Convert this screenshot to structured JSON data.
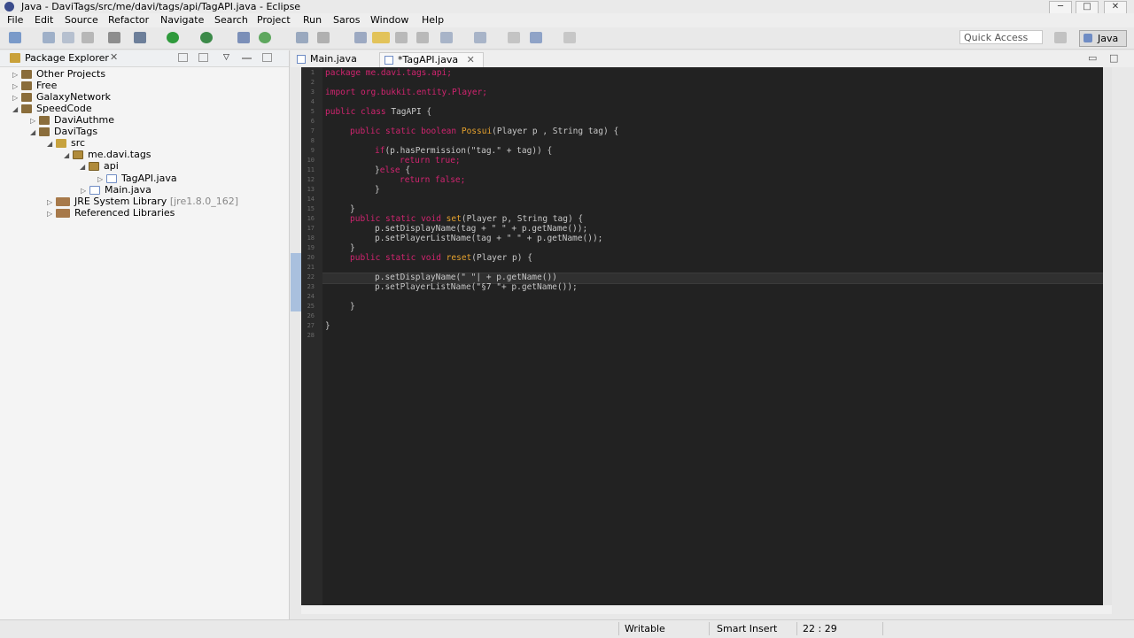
{
  "window": {
    "title": "Java - DaviTags/src/me/davi/tags/api/TagAPI.java - Eclipse",
    "minimize": "─",
    "maximize": "□",
    "close": "✕"
  },
  "menu": [
    "File",
    "Edit",
    "Source",
    "Refactor",
    "Navigate",
    "Search",
    "Project",
    "Run",
    "Saros",
    "Window",
    "Help"
  ],
  "toolbar": {
    "quick_access_placeholder": "Quick Access",
    "perspective_label": "Java"
  },
  "package_explorer": {
    "title": "Package Explorer",
    "close": "✕",
    "tree": [
      {
        "label": "Other Projects",
        "arrow": "▷",
        "icon": "project"
      },
      {
        "label": "Free",
        "arrow": "▷",
        "icon": "project"
      },
      {
        "label": "GalaxyNetwork",
        "arrow": "▷",
        "icon": "project"
      },
      {
        "label": "SpeedCode",
        "arrow": "◢",
        "icon": "project"
      },
      {
        "label": "DaviAuthme",
        "arrow": "▷",
        "icon": "project"
      },
      {
        "label": "DaviTags",
        "arrow": "◢",
        "icon": "project"
      },
      {
        "label": "src",
        "arrow": "◢",
        "icon": "source-folder"
      },
      {
        "label": "me.davi.tags",
        "arrow": "◢",
        "icon": "package"
      },
      {
        "label": "api",
        "arrow": "◢",
        "icon": "package"
      },
      {
        "label": "TagAPI.java",
        "arrow": "▷",
        "icon": "java-file"
      },
      {
        "label": "Main.java",
        "arrow": "▷",
        "icon": "java-file"
      },
      {
        "label": "JRE System Library",
        "suffix": "[jre1.8.0_162]",
        "arrow": "▷",
        "icon": "library"
      },
      {
        "label": "Referenced Libraries",
        "arrow": "▷",
        "icon": "library"
      }
    ]
  },
  "editor": {
    "tabs": [
      {
        "label": "Main.java",
        "active": false
      },
      {
        "label": "*TagAPI.java",
        "close": "✕",
        "active": true
      }
    ],
    "line_numbers": [
      "1",
      "2",
      "3",
      "4",
      "5",
      "6",
      "7",
      "8",
      "9",
      "10",
      "11",
      "12",
      "13",
      "14",
      "15",
      "16",
      "17",
      "18",
      "19",
      "20",
      "21",
      "22",
      "23",
      "24",
      "25",
      "26",
      "27",
      "28"
    ],
    "code": {
      "l1": "package me.davi.tags.api;",
      "l3": "import org.bukkit.entity.Player;",
      "l5a": "public class ",
      "l5b": "TagAPI {",
      "l7a": "public static boolean ",
      "l7b": "Possui",
      "l7c": "(Player p , String tag) {",
      "l9a": "if",
      "l9b": "(p.hasPermission(\"tag.\" + tag)) {",
      "l10": "return true;",
      "l11a": "}",
      "l11b": "else",
      "l11c": " {",
      "l12": "return false;",
      "l13": "}",
      "l15": "}",
      "l16a": "public static void ",
      "l16b": "set",
      "l16c": "(Player p, String tag) {",
      "l17": "p.setDisplayName(tag + \" \" + p.getName());",
      "l18": "p.setPlayerListName(tag + \" \" + p.getName());",
      "l19": "}",
      "l20a": "public static void ",
      "l20b": "reset",
      "l20c": "(Player p) {",
      "l22": "p.setDisplayName(\" \"| + p.getName())",
      "l23": "p.setPlayerListName(\"§7 \"+ p.getName());",
      "l25": "}",
      "l27": "}"
    }
  },
  "status_bar": {
    "mode": "Writable",
    "insert": "Smart Insert",
    "position": "22 : 29"
  }
}
